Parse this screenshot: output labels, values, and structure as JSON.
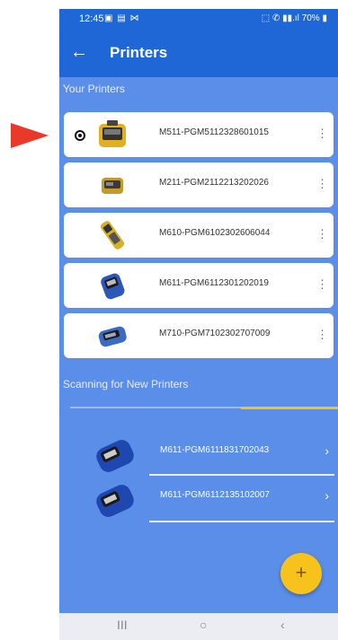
{
  "status_bar": {
    "time": "12:45",
    "left_icons": "▣ ▤ ⋈",
    "right_icons": "⬚ ✆ ▮▮.ıl",
    "battery": "70%"
  },
  "app_bar": {
    "title": "Printers",
    "back_icon": "←"
  },
  "your_printers": {
    "title": "Your Printers",
    "items": [
      {
        "label": "M511-PGM5112328601015",
        "selected": true,
        "color": "#e0b020"
      },
      {
        "label": "M211-PGM2112213202026",
        "selected": false,
        "color": "#c49a2a"
      },
      {
        "label": "M610-PGM6102302606044",
        "selected": false,
        "color": "#d8b024"
      },
      {
        "label": "M611-PGM6112301202019",
        "selected": false,
        "color": "#2c56b8"
      },
      {
        "label": "M710-PGM7102302707009",
        "selected": false,
        "color": "#3a6ac6"
      }
    ]
  },
  "kebab_icon": "⋮",
  "scanning": {
    "title": "Scanning for New Printers",
    "items": [
      {
        "label": "M611-PGM6111831702043",
        "chevron": "›"
      },
      {
        "label": "M611-PGM6112135102007",
        "chevron": "›"
      }
    ]
  },
  "fab": {
    "label": "+"
  },
  "nav": {
    "recents": "III",
    "home": "○",
    "back": "‹"
  },
  "colors": {
    "primary": "#1f67d6",
    "background": "#5b8ee8",
    "accent": "#f7c21b",
    "marker": "#e8392b"
  }
}
